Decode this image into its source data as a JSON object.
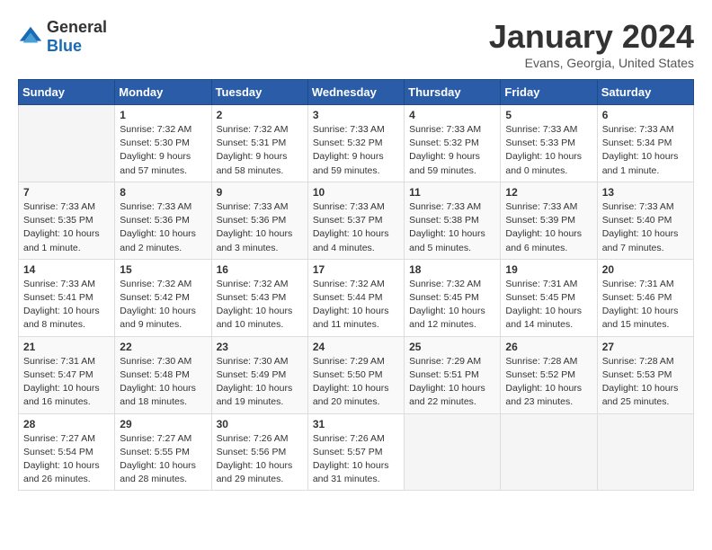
{
  "logo": {
    "general": "General",
    "blue": "Blue"
  },
  "title": "January 2024",
  "subtitle": "Evans, Georgia, United States",
  "days_header": [
    "Sunday",
    "Monday",
    "Tuesday",
    "Wednesday",
    "Thursday",
    "Friday",
    "Saturday"
  ],
  "weeks": [
    [
      {
        "day": "",
        "info": ""
      },
      {
        "day": "1",
        "info": "Sunrise: 7:32 AM\nSunset: 5:30 PM\nDaylight: 9 hours\nand 57 minutes."
      },
      {
        "day": "2",
        "info": "Sunrise: 7:32 AM\nSunset: 5:31 PM\nDaylight: 9 hours\nand 58 minutes."
      },
      {
        "day": "3",
        "info": "Sunrise: 7:33 AM\nSunset: 5:32 PM\nDaylight: 9 hours\nand 59 minutes."
      },
      {
        "day": "4",
        "info": "Sunrise: 7:33 AM\nSunset: 5:32 PM\nDaylight: 9 hours\nand 59 minutes."
      },
      {
        "day": "5",
        "info": "Sunrise: 7:33 AM\nSunset: 5:33 PM\nDaylight: 10 hours\nand 0 minutes."
      },
      {
        "day": "6",
        "info": "Sunrise: 7:33 AM\nSunset: 5:34 PM\nDaylight: 10 hours\nand 1 minute."
      }
    ],
    [
      {
        "day": "7",
        "info": "Sunrise: 7:33 AM\nSunset: 5:35 PM\nDaylight: 10 hours\nand 1 minute."
      },
      {
        "day": "8",
        "info": "Sunrise: 7:33 AM\nSunset: 5:36 PM\nDaylight: 10 hours\nand 2 minutes."
      },
      {
        "day": "9",
        "info": "Sunrise: 7:33 AM\nSunset: 5:36 PM\nDaylight: 10 hours\nand 3 minutes."
      },
      {
        "day": "10",
        "info": "Sunrise: 7:33 AM\nSunset: 5:37 PM\nDaylight: 10 hours\nand 4 minutes."
      },
      {
        "day": "11",
        "info": "Sunrise: 7:33 AM\nSunset: 5:38 PM\nDaylight: 10 hours\nand 5 minutes."
      },
      {
        "day": "12",
        "info": "Sunrise: 7:33 AM\nSunset: 5:39 PM\nDaylight: 10 hours\nand 6 minutes."
      },
      {
        "day": "13",
        "info": "Sunrise: 7:33 AM\nSunset: 5:40 PM\nDaylight: 10 hours\nand 7 minutes."
      }
    ],
    [
      {
        "day": "14",
        "info": "Sunrise: 7:33 AM\nSunset: 5:41 PM\nDaylight: 10 hours\nand 8 minutes."
      },
      {
        "day": "15",
        "info": "Sunrise: 7:32 AM\nSunset: 5:42 PM\nDaylight: 10 hours\nand 9 minutes."
      },
      {
        "day": "16",
        "info": "Sunrise: 7:32 AM\nSunset: 5:43 PM\nDaylight: 10 hours\nand 10 minutes."
      },
      {
        "day": "17",
        "info": "Sunrise: 7:32 AM\nSunset: 5:44 PM\nDaylight: 10 hours\nand 11 minutes."
      },
      {
        "day": "18",
        "info": "Sunrise: 7:32 AM\nSunset: 5:45 PM\nDaylight: 10 hours\nand 12 minutes."
      },
      {
        "day": "19",
        "info": "Sunrise: 7:31 AM\nSunset: 5:45 PM\nDaylight: 10 hours\nand 14 minutes."
      },
      {
        "day": "20",
        "info": "Sunrise: 7:31 AM\nSunset: 5:46 PM\nDaylight: 10 hours\nand 15 minutes."
      }
    ],
    [
      {
        "day": "21",
        "info": "Sunrise: 7:31 AM\nSunset: 5:47 PM\nDaylight: 10 hours\nand 16 minutes."
      },
      {
        "day": "22",
        "info": "Sunrise: 7:30 AM\nSunset: 5:48 PM\nDaylight: 10 hours\nand 18 minutes."
      },
      {
        "day": "23",
        "info": "Sunrise: 7:30 AM\nSunset: 5:49 PM\nDaylight: 10 hours\nand 19 minutes."
      },
      {
        "day": "24",
        "info": "Sunrise: 7:29 AM\nSunset: 5:50 PM\nDaylight: 10 hours\nand 20 minutes."
      },
      {
        "day": "25",
        "info": "Sunrise: 7:29 AM\nSunset: 5:51 PM\nDaylight: 10 hours\nand 22 minutes."
      },
      {
        "day": "26",
        "info": "Sunrise: 7:28 AM\nSunset: 5:52 PM\nDaylight: 10 hours\nand 23 minutes."
      },
      {
        "day": "27",
        "info": "Sunrise: 7:28 AM\nSunset: 5:53 PM\nDaylight: 10 hours\nand 25 minutes."
      }
    ],
    [
      {
        "day": "28",
        "info": "Sunrise: 7:27 AM\nSunset: 5:54 PM\nDaylight: 10 hours\nand 26 minutes."
      },
      {
        "day": "29",
        "info": "Sunrise: 7:27 AM\nSunset: 5:55 PM\nDaylight: 10 hours\nand 28 minutes."
      },
      {
        "day": "30",
        "info": "Sunrise: 7:26 AM\nSunset: 5:56 PM\nDaylight: 10 hours\nand 29 minutes."
      },
      {
        "day": "31",
        "info": "Sunrise: 7:26 AM\nSunset: 5:57 PM\nDaylight: 10 hours\nand 31 minutes."
      },
      {
        "day": "",
        "info": ""
      },
      {
        "day": "",
        "info": ""
      },
      {
        "day": "",
        "info": ""
      }
    ]
  ]
}
